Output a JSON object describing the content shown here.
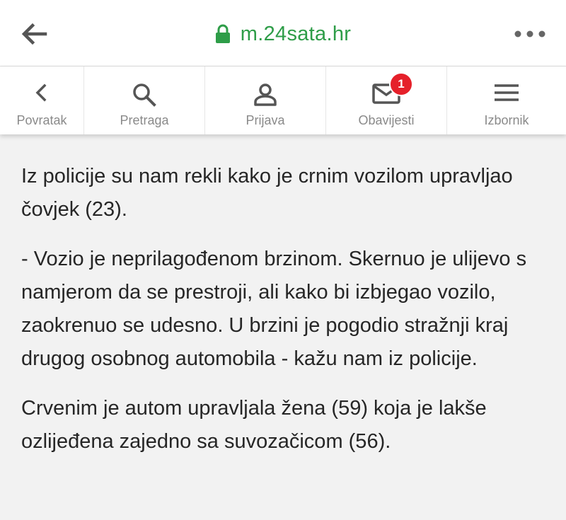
{
  "browser": {
    "url": "m.24sata.hr",
    "back_icon": "arrow-left-icon",
    "lock_icon": "lock-icon",
    "menu_icon": "more-dots-icon",
    "url_color": "#2e9d48"
  },
  "nav": {
    "items": [
      {
        "label": "Povratak",
        "icon": "chevron-left-icon"
      },
      {
        "label": "Pretraga",
        "icon": "search-icon"
      },
      {
        "label": "Prijava",
        "icon": "user-icon"
      },
      {
        "label": "Obavijesti",
        "icon": "mail-icon",
        "badge": "1"
      },
      {
        "label": "Izbornik",
        "icon": "hamburger-menu-icon"
      }
    ],
    "badge_color": "#e5202a"
  },
  "article": {
    "paragraphs": [
      "Iz policije su nam rekli kako je crnim vozilom upravljao čovjek (23).",
      "- Vozio je neprilagođenom brzinom. Skernuo je ulijevo s namjerom da se prestroji, ali kako bi izbjegao vozilo, zaokrenuo se udesno. U brzini je pogodio stražnji kraj drugog osobnog automobila - kažu nam iz policije.",
      "Crvenim je autom upravljala žena (59) koja je lakše ozlijeđena zajedno sa suvozačicom (56)."
    ]
  }
}
